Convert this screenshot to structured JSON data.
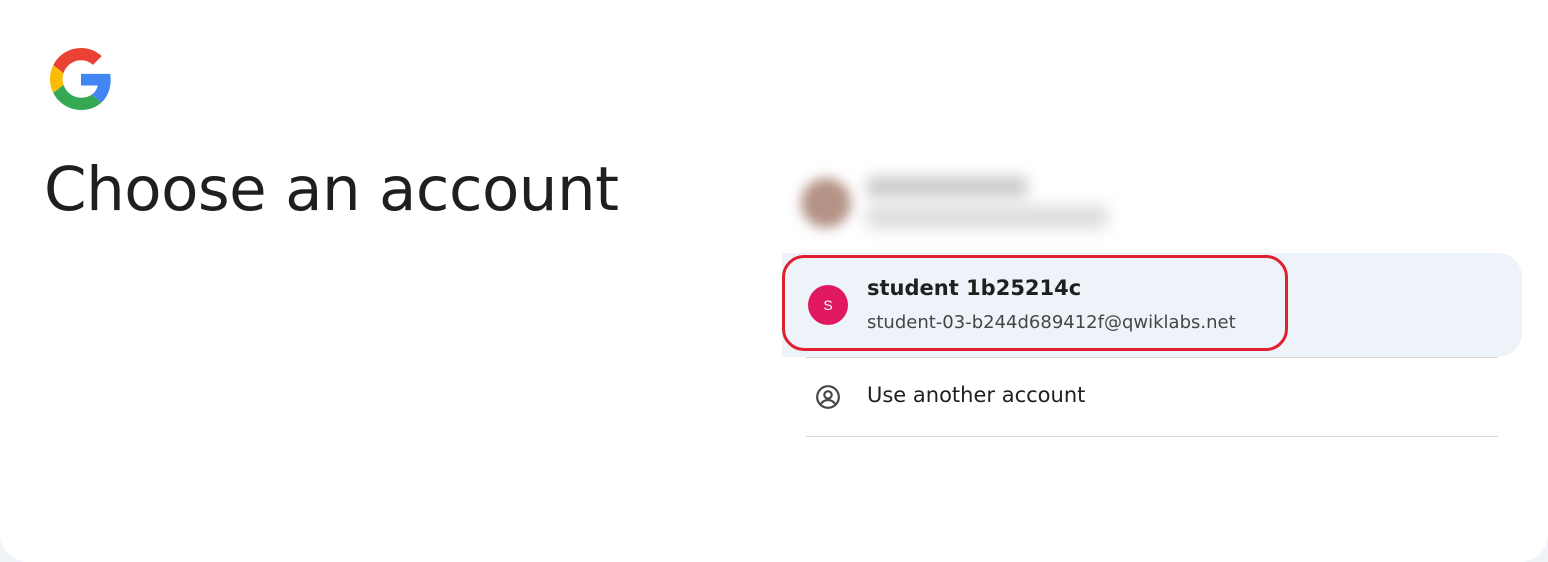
{
  "page": {
    "title": "Choose an account"
  },
  "logo": {
    "icon": "google-g-icon",
    "colors": {
      "blue": "#4285F4",
      "red": "#EA4335",
      "yellow": "#FBBC05",
      "green": "#34A853"
    }
  },
  "accounts": [
    {
      "name": "student 1b25214c",
      "email": "student-03-b244d689412f@qwiklabs.net",
      "avatar_letter": "S",
      "avatar_color": "#e0185f",
      "highlighted": true,
      "highlight_color": "#e0202e"
    }
  ],
  "use_another": {
    "label": "Use another account",
    "icon": "account-circle-icon"
  }
}
